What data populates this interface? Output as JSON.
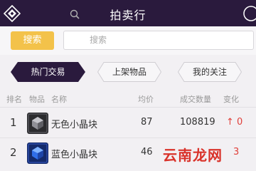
{
  "header": {
    "title": "拍卖行"
  },
  "search": {
    "button_label": "搜索",
    "placeholder": "搜索"
  },
  "tabs": [
    {
      "label": "热门交易",
      "active": true
    },
    {
      "label": "上架物品",
      "active": false
    },
    {
      "label": "我的关注",
      "active": false
    }
  ],
  "table": {
    "columns": {
      "rank": "排名",
      "item": "物品",
      "name": "名称",
      "price": "均价",
      "volume": "成交数量",
      "change": "变化"
    },
    "rows": [
      {
        "rank": "1",
        "name": "无色小晶块",
        "price": "87",
        "volume": "108819",
        "change_arrow": "↑",
        "change": "0",
        "icon": "colorless-crystal-icon"
      },
      {
        "rank": "2",
        "name": "蓝色小晶块",
        "price": "46",
        "volume": "",
        "change_arrow": "",
        "change": "3",
        "icon": "blue-crystal-icon"
      }
    ]
  },
  "watermark": "云南龙网",
  "colors": {
    "header_bg": "#2a1a3d",
    "accent": "#f3c24a",
    "active_tab": "#2a1a3d",
    "change_red": "#e0403a"
  }
}
